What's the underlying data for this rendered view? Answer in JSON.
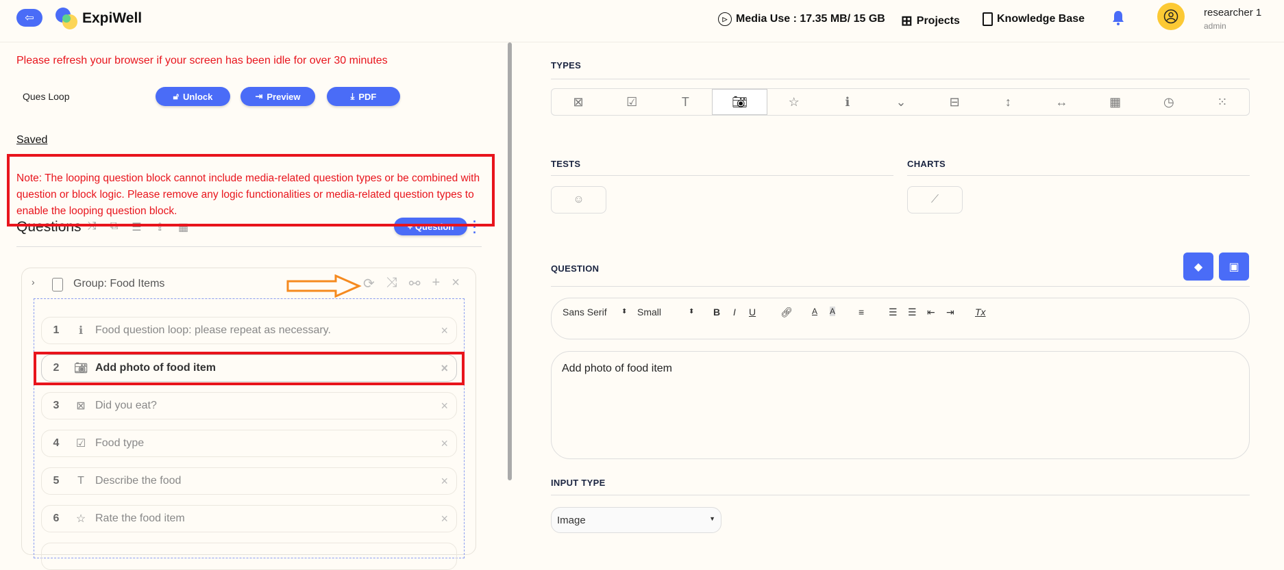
{
  "header": {
    "brand": "ExpiWell",
    "media_use": "Media Use : 17.35 MB/ 15 GB",
    "projects": "Projects",
    "knowledge_base": "Knowledge Base",
    "user_name": "researcher 1",
    "user_role": "admin"
  },
  "left": {
    "refresh_notice": "Please refresh your browser if your screen has been idle for over 30 minutes",
    "survey_name": "Ques Loop",
    "buttons": {
      "unlock": "Unlock",
      "preview": "Preview",
      "pdf": "PDF"
    },
    "saved": "Saved",
    "note": "Note: The looping question block cannot include media-related question types or be combined with question or block logic. Please remove any logic functionalities or media-related question types to enable the looping question block.",
    "questions_title": "Questions",
    "add_question": "+ Question",
    "group_title": "Group: Food Items",
    "questions": [
      {
        "num": "1",
        "icon": "info-icon",
        "text": "Food question loop: please repeat as necessary."
      },
      {
        "num": "2",
        "icon": "camera-icon",
        "text": "Add photo of food item"
      },
      {
        "num": "3",
        "icon": "single-choice-icon",
        "text": "Did you eat?"
      },
      {
        "num": "4",
        "icon": "checkbox-icon",
        "text": "Food type"
      },
      {
        "num": "5",
        "icon": "text-icon",
        "text": "Describe the food"
      },
      {
        "num": "6",
        "icon": "star-icon",
        "text": "Rate the food item"
      }
    ]
  },
  "right": {
    "types_label": "TYPES",
    "types": [
      "single-choice-icon",
      "checkbox-icon",
      "text-icon",
      "camera-icon",
      "star-icon",
      "info-icon",
      "dropdown-icon",
      "matrix-icon",
      "vertical-slider-icon",
      "horizontal-slider-icon",
      "grid-icon",
      "clock-icon",
      "apps-icon"
    ],
    "selected_type": "camera-icon",
    "tests_label": "TESTS",
    "charts_label": "CHARTS",
    "question_label": "QUESTION",
    "toolbar": {
      "font": "Sans Serif",
      "size": "Small",
      "bold": "B",
      "italic": "I",
      "underline": "U",
      "color": "A",
      "background": "A",
      "clear": "Tx"
    },
    "question_text": "Add photo of food item",
    "input_type_label": "INPUT TYPE",
    "input_type_value": "Image"
  },
  "colors": {
    "accent": "#4a6cf7",
    "warning": "#e8141c",
    "annotation_arrow": "#f58a1f",
    "avatar": "#fcc934"
  }
}
